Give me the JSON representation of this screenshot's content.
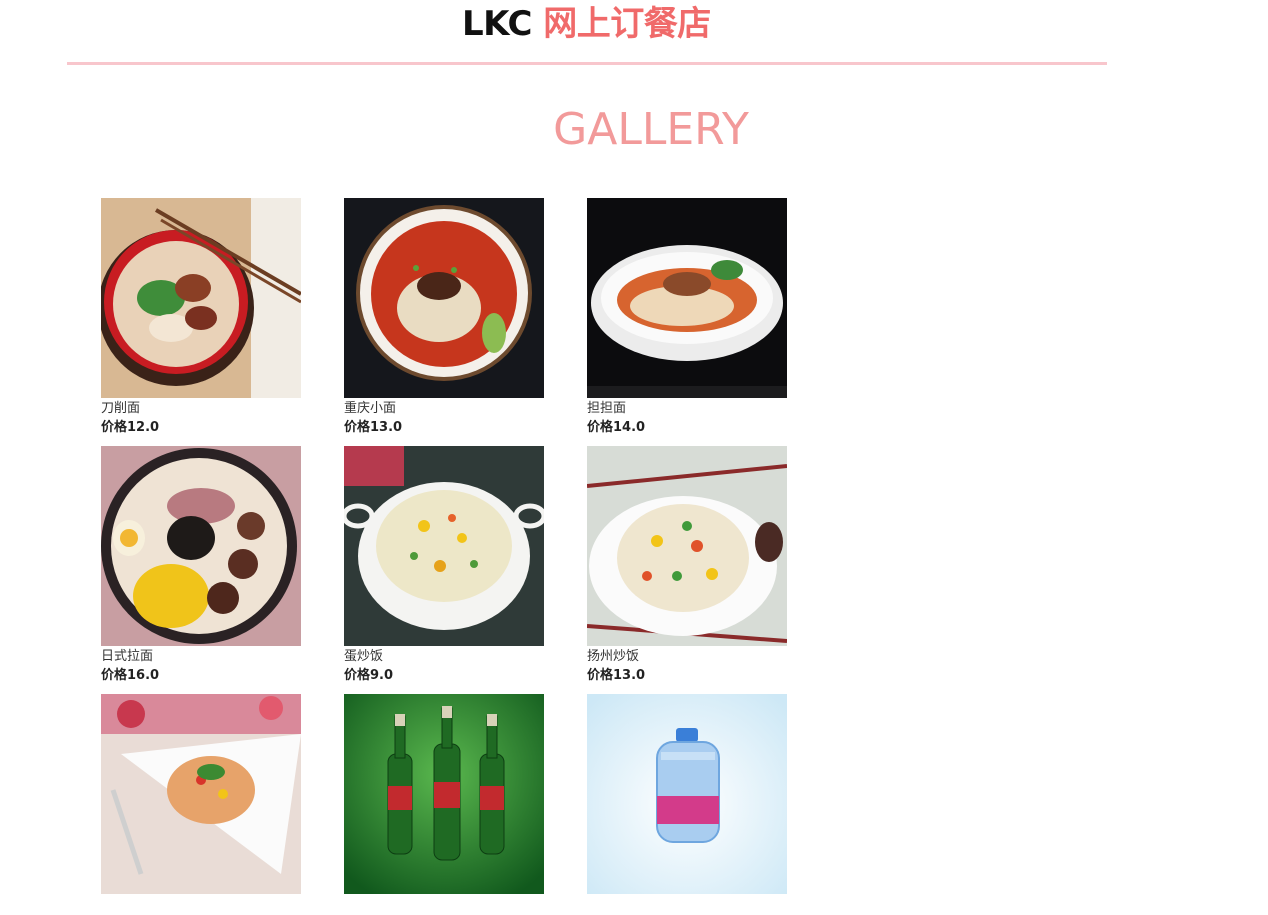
{
  "header": {
    "brand_latin": "LKC",
    "brand_cn": "网上订餐店",
    "brand_color": "#f06a6a"
  },
  "gallery": {
    "title": "GALLERY",
    "accent": "#f29a9a",
    "items": [
      {
        "name": "刀削面",
        "price": "价格12.0",
        "image": "daoxiao-noodle-bowl"
      },
      {
        "name": "重庆小面",
        "price": "价格13.0",
        "image": "chongqing-noodle-bowl"
      },
      {
        "name": "担担面",
        "price": "价格14.0",
        "image": "dandan-noodle-bowl"
      },
      {
        "name": "日式拉面",
        "price": "价格16.0",
        "image": "ramen-bowl"
      },
      {
        "name": "蛋炒饭",
        "price": "价格9.0",
        "image": "egg-fried-rice-plate"
      },
      {
        "name": "扬州炒饭",
        "price": "价格13.0",
        "image": "yangzhou-fried-rice-plate"
      },
      {
        "name": "",
        "price": "",
        "image": "fried-rice-dish"
      },
      {
        "name": "",
        "price": "",
        "image": "beer-bottles"
      },
      {
        "name": "",
        "price": "",
        "image": "water-bottle"
      }
    ]
  }
}
